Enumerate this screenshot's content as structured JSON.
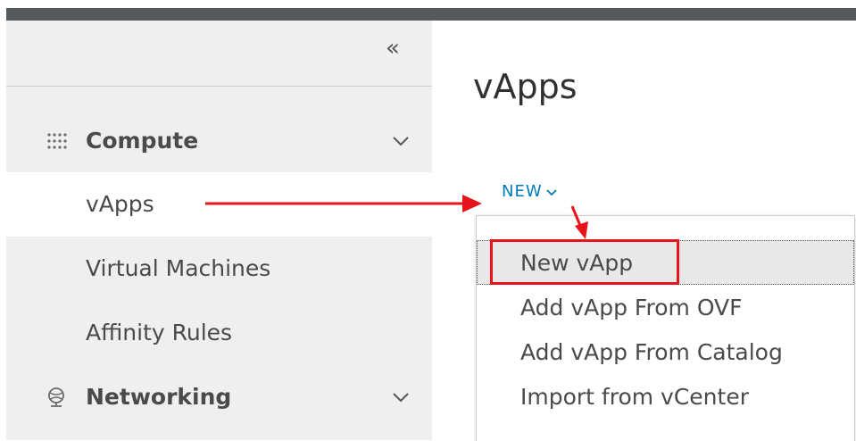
{
  "sidebar": {
    "collapse_label": "«",
    "groups": [
      {
        "label": "Compute",
        "icon": "grid-icon"
      },
      {
        "label": "Networking",
        "icon": "network-globe-icon"
      }
    ],
    "items": [
      {
        "label": "vApps",
        "active": true
      },
      {
        "label": "Virtual Machines",
        "active": false
      },
      {
        "label": "Affinity Rules",
        "active": false
      }
    ]
  },
  "main": {
    "title": "vApps",
    "new_button_label": "NEW"
  },
  "dropdown": {
    "items": [
      {
        "label": "New vApp",
        "focused": true
      },
      {
        "label": "Add vApp From OVF"
      },
      {
        "label": "Add vApp From Catalog"
      },
      {
        "label": "Import from vCenter"
      }
    ]
  },
  "colors": {
    "accent": "#0079b8",
    "annotation": "#e8141b",
    "topbar": "#555a5f",
    "sidebar_bg": "#efefef"
  }
}
